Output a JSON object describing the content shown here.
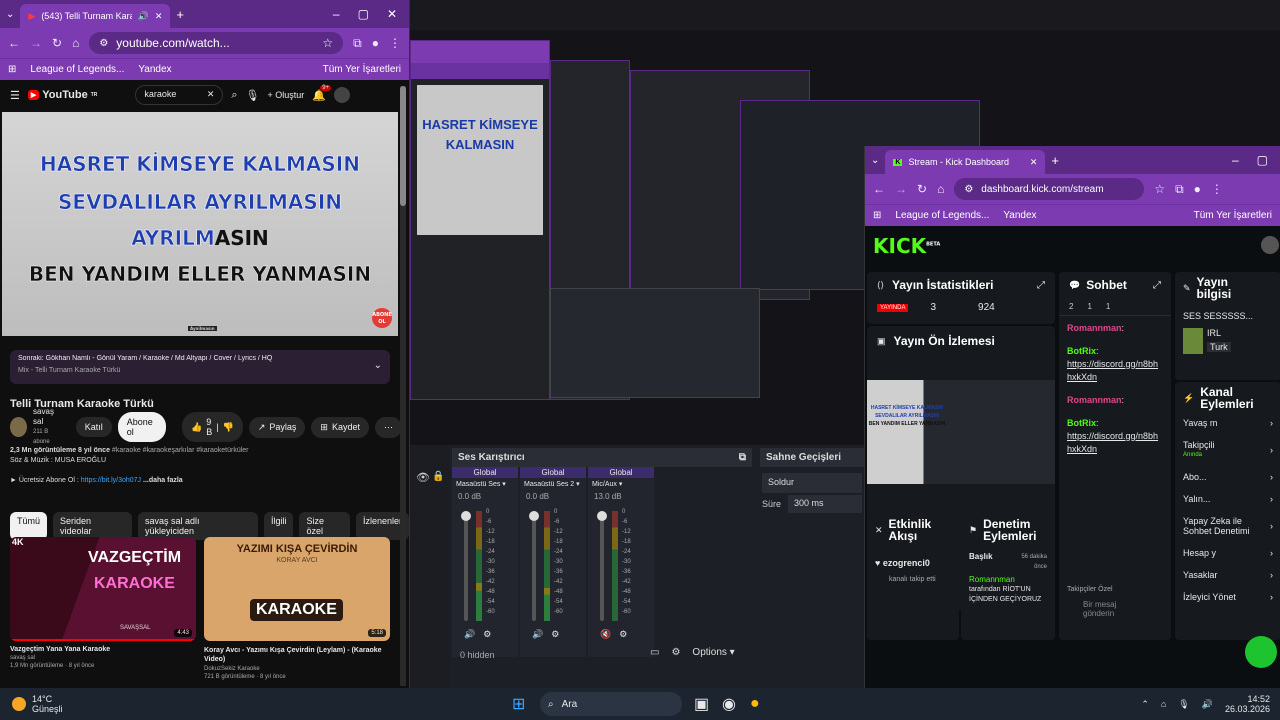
{
  "youtube_window": {
    "tab_title": "(543) Telli Turnam Karaoke Türkü",
    "url": "youtube.com/watch...",
    "bookmarks": [
      "League of Legends...",
      "Yandex"
    ],
    "bookmarks_folder": "Tüm Yer İşaretleri",
    "search_value": "karaoke",
    "create_label": "Oluştur",
    "notif_count": "9+",
    "logo": "YouTube",
    "logo_sup": "TR",
    "lyrics": [
      "HASRET KİMSEYE KALMASIN",
      "SEVDALILAR AYRILMASIN",
      "AYRILMASIN",
      "BEN YANDIM ELLER YANMASIN"
    ],
    "lyric3_played": "AYRILM",
    "lyric3_rest": "ASIN",
    "channel_watermark": "Aynilmasın",
    "subscribe_badge": "ABONE OL",
    "next_up": "Sonraki: Gökhan Namlı - Gönül Yaram / Karaoke / Md Altyapı / Cover / Lyrics / HQ",
    "mix": "Mix - Telli Turnam Karaoke Türkü",
    "video_title": "Telli Turnam Karaoke Türkü",
    "channel": "savaş sal",
    "subs": "211 B abone",
    "join": "Katıl",
    "subscribe": "Abone ol",
    "likes": "9 B",
    "share": "Paylaş",
    "save": "Kaydet",
    "views_line": "2,3 Mn görüntüleme  8 yıl önce",
    "tags": "#karaoke #karaokeşarkılar #karaoketürküler",
    "desc_line": "Söz & Müzik : MUSA EROĞLU",
    "promo": "► Ücretsiz Abone Ol : ",
    "promo_link": "https://bit.ly/3oh07J",
    "more": "...daha fazla",
    "chips": [
      "Tümü",
      "Seriden videolar",
      "savaş sal adlı yükleyiciden",
      "İlgili",
      "Size özel",
      "İzlenenler"
    ],
    "recs": [
      {
        "thumb_title": "VAZGEÇTİM",
        "thumb_sub": "KARAOKE",
        "thumb_tag": "4K",
        "thumb_brand": "SAVAŞSAL",
        "duration": "4:43",
        "title": "Vazgeçtim Yana Yana Karaoke",
        "channel": "savaş sal",
        "meta": "1,9 Mn görüntüleme · 8 yıl önce"
      },
      {
        "thumb_title": "YAZIMI KIŞA ÇEVİRDİN",
        "thumb_sub": "KORAY AVCI",
        "thumb_tag": "KARAOKE",
        "thumb_brand": "",
        "duration": "5:18",
        "title": "Koray Avcı - Yazımı Kışa Çevirdin (Leylam) - (Karaoke Video)",
        "channel": "DokuzSekiz Karaoke",
        "meta": "721 B görüntüleme · 8 yıl önce"
      }
    ]
  },
  "obs": {
    "mixer_title": "Ses Karıştırıcı",
    "scene_title": "Sahne Geçişleri",
    "channels": [
      {
        "scope": "Global",
        "name": "Masaüstü Ses",
        "db": "0.0 dB",
        "level": 0.35
      },
      {
        "scope": "Global",
        "name": "Masaüstü Ses 2",
        "db": "0.0 dB",
        "level": 0.3
      },
      {
        "scope": "Global",
        "name": "Mic/Aux",
        "db": "13.0 dB",
        "level": 0.0
      }
    ],
    "scale": [
      "0",
      "-6",
      "-12",
      "-18",
      "-24",
      "-30",
      "-36",
      "-42",
      "-48",
      "-54",
      "-60"
    ],
    "transition": "Soldur",
    "duration_label": "Süre",
    "duration_value": "300 ms",
    "hidden": "0 hidden",
    "options": "Options"
  },
  "kick_window": {
    "tab_title": "Stream - Kick Dashboard",
    "url": "dashboard.kick.com/stream",
    "bookmarks": [
      "League of Legends...",
      "Yandex"
    ],
    "bookmarks_folder": "Tüm Yer İşaretleri",
    "logo": "KICK",
    "logo_sup": "BETA",
    "stats_title": "Yayın İstatistikleri",
    "stats_badge": "YAYINDA",
    "stats_vals": [
      "3",
      "924"
    ],
    "preview_title": "Yayın Ön İzlemesi",
    "chat_title": "Sohbet",
    "chat_counts": [
      "2",
      "1",
      "1"
    ],
    "chat": [
      {
        "user": "Romannman",
        "text": ""
      },
      {
        "user": "BotRix",
        "text": "https://discord.gg/n8bhhxkXdn"
      },
      {
        "user": "Romannman",
        "text": ""
      },
      {
        "user": "BotRix",
        "text": "https://discord.gg/n8bhhxkXdn"
      }
    ],
    "follower_only": "Takipçiler Özel",
    "chat_placeholder": "Bir mesaj gönderin",
    "info_title": "Yayın bilgisi",
    "stream_title": "SES SESSSSS...",
    "category": "IRL",
    "language": "Turk",
    "actions_title": "Kanal Eylemleri",
    "actions": [
      {
        "label": "Yavaş m",
        "sub": ""
      },
      {
        "label": "Takipçili",
        "sub": "Anında"
      },
      {
        "label": "Abo...",
        "sub": ""
      },
      {
        "label": "Yalın...",
        "sub": ""
      },
      {
        "label": "Yapay Zeka ile Sohbet Denetimi",
        "sub": ""
      },
      {
        "label": "Hesap y",
        "sub": ""
      },
      {
        "label": "Yasaklar",
        "sub": ""
      },
      {
        "label": "İzleyici Yönet",
        "sub": ""
      }
    ],
    "activity_title": "Etkinlik Akışı",
    "activity_user": "ezogrenci0",
    "activity_text": "kanalı takip etti",
    "mod_title": "Denetim Eylemleri",
    "mod_item_title": "Başlık",
    "mod_item_time": "56 dakika önce",
    "mod_item_user": "Romannman",
    "mod_item_text": "tarafından RİOT'UN İÇİNDEN GEÇİYORUZ"
  },
  "taskbar": {
    "temp": "14°C",
    "weather": "Güneşli",
    "search": "Ara",
    "time": "14:52",
    "date": "26.03.2026"
  },
  "colors": {
    "chrome_purple": "#7c3bb0",
    "kick_green": "#53fc18",
    "yt_red": "#ff0000"
  }
}
